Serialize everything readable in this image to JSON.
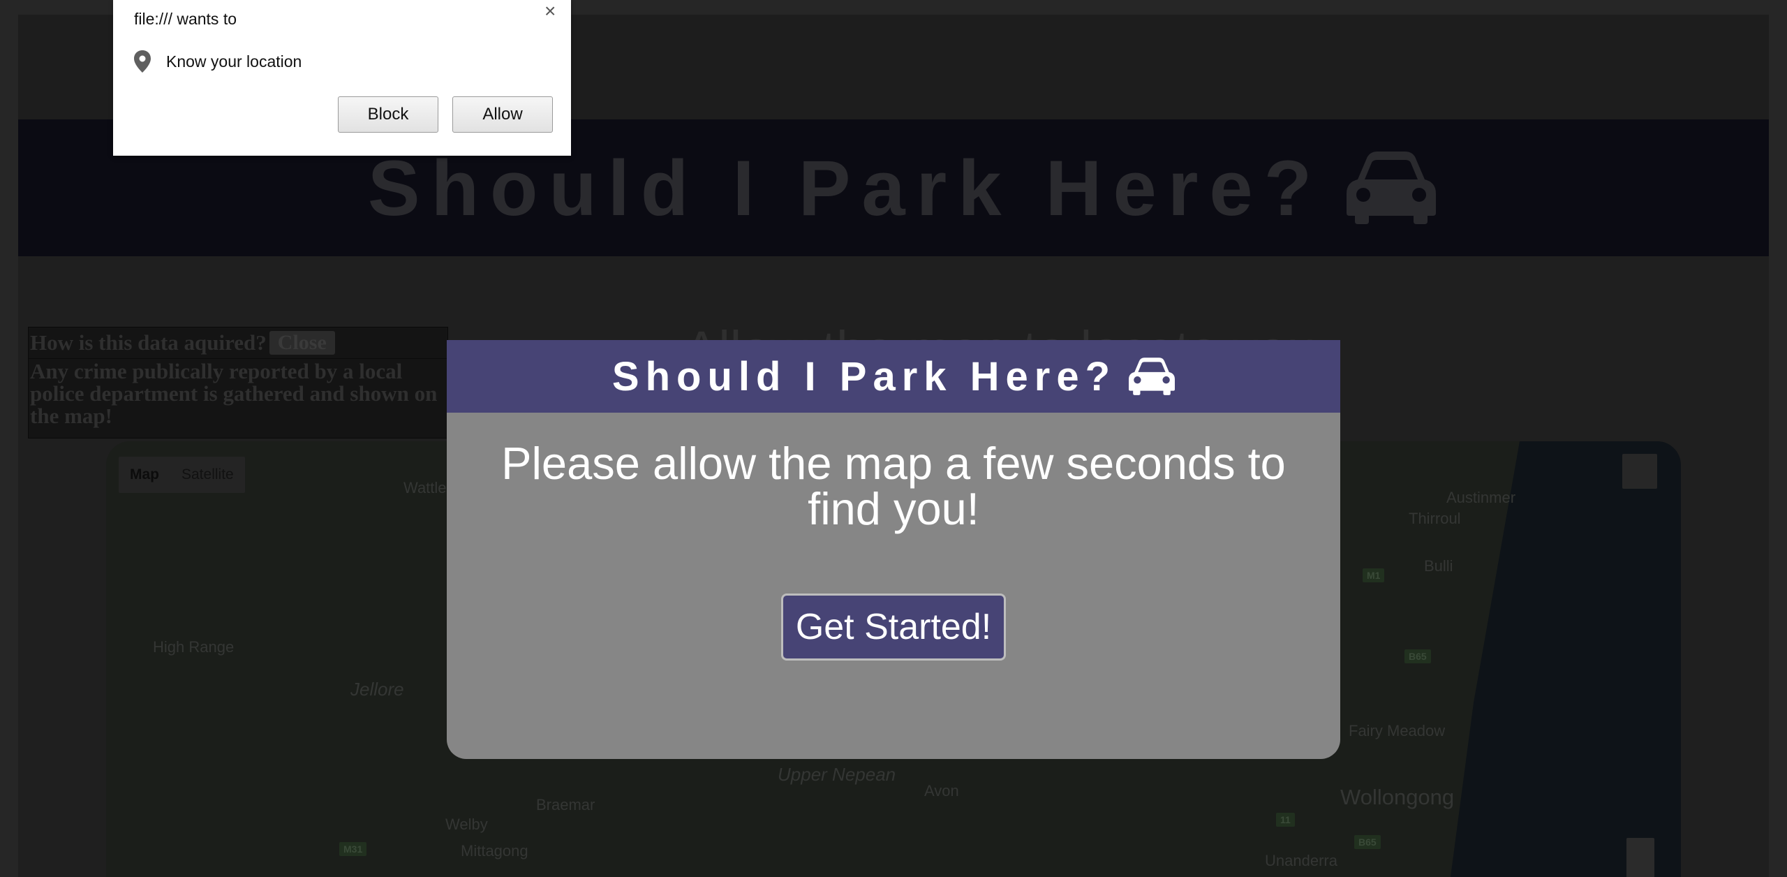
{
  "page": {
    "title": "Should I Park Here?",
    "faded_subtitle": "Allow the map to locate you",
    "colors": {
      "header_bg": "#474475",
      "modal_bg": "#868686",
      "overlay": "#262626"
    }
  },
  "info_box": {
    "question": "How is this data aquired?",
    "close_label": "Close",
    "answer": "Any crime publically reported by a local police department is gathered and shown on the map!"
  },
  "map": {
    "type_buttons": [
      "Map",
      "Satellite"
    ],
    "places": {
      "wattle": "Wattle",
      "high_range": "High Range",
      "jellore": "Jellore",
      "braemar": "Braemar",
      "welby": "Welby",
      "mittagong": "Mittagong",
      "upper_nepean": "Upper Nepean",
      "avon": "Avon",
      "austinmer": "Austinmer",
      "thirroul": "Thirroul",
      "bulli": "Bulli",
      "fairy_meadow": "Fairy Meadow",
      "wollongong": "Wollongong",
      "unanderra": "Unanderra"
    },
    "road_badges": {
      "m1": "M1",
      "b65a": "B65",
      "b65b": "B65",
      "m31": "M31",
      "r11": "11"
    }
  },
  "modal": {
    "title": "Should I Park Here?",
    "icon": "car-icon",
    "message": "Please allow the map a few seconds to find you!",
    "button_label": "Get Started!"
  },
  "permission_popup": {
    "title": "file:/// wants to",
    "request": "Know your location",
    "block_label": "Block",
    "allow_label": "Allow",
    "close_glyph": "×"
  }
}
